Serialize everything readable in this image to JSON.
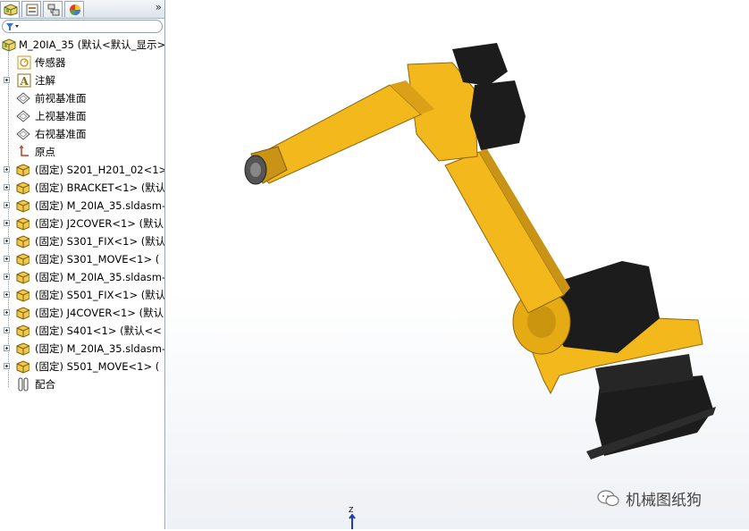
{
  "feature_tree": {
    "root": "M_20IA_35  (默认<默认_显示>",
    "items": [
      {
        "label": "传感器",
        "type": "sensor"
      },
      {
        "label": "注解",
        "type": "annotation"
      },
      {
        "label": "前视基准面",
        "type": "plane"
      },
      {
        "label": "上视基准面",
        "type": "plane"
      },
      {
        "label": "右视基准面",
        "type": "plane"
      },
      {
        "label": "原点",
        "type": "origin"
      },
      {
        "label": "(固定) S201_H201_02<1>",
        "type": "part"
      },
      {
        "label": "(固定) BRACKET<1> (默认",
        "type": "part"
      },
      {
        "label": "(固定) M_20IA_35.sldasm-",
        "type": "part"
      },
      {
        "label": "(固定) J2COVER<1> (默认",
        "type": "part"
      },
      {
        "label": "(固定) S301_FIX<1> (默认",
        "type": "part"
      },
      {
        "label": "(固定) S301_MOVE<1> (",
        "type": "part"
      },
      {
        "label": "(固定) M_20IA_35.sldasm-",
        "type": "part"
      },
      {
        "label": "(固定) S501_FIX<1> (默认",
        "type": "part"
      },
      {
        "label": "(固定) J4COVER<1> (默认",
        "type": "part"
      },
      {
        "label": "(固定) S401<1> (默认<<",
        "type": "part"
      },
      {
        "label": "(固定) M_20IA_35.sldasm-",
        "type": "part"
      },
      {
        "label": "(固定) S501_MOVE<1> (",
        "type": "part"
      },
      {
        "label": "配合",
        "type": "mates"
      }
    ]
  },
  "toolbar": {
    "more_label": "»"
  },
  "viewport": {
    "triad_label": "Z"
  },
  "watermark": {
    "text": "机械图纸狗"
  },
  "colors": {
    "robot_yellow": "#f2b81c",
    "robot_black": "#1c1c1c",
    "panel_border": "#9aa7b8"
  }
}
